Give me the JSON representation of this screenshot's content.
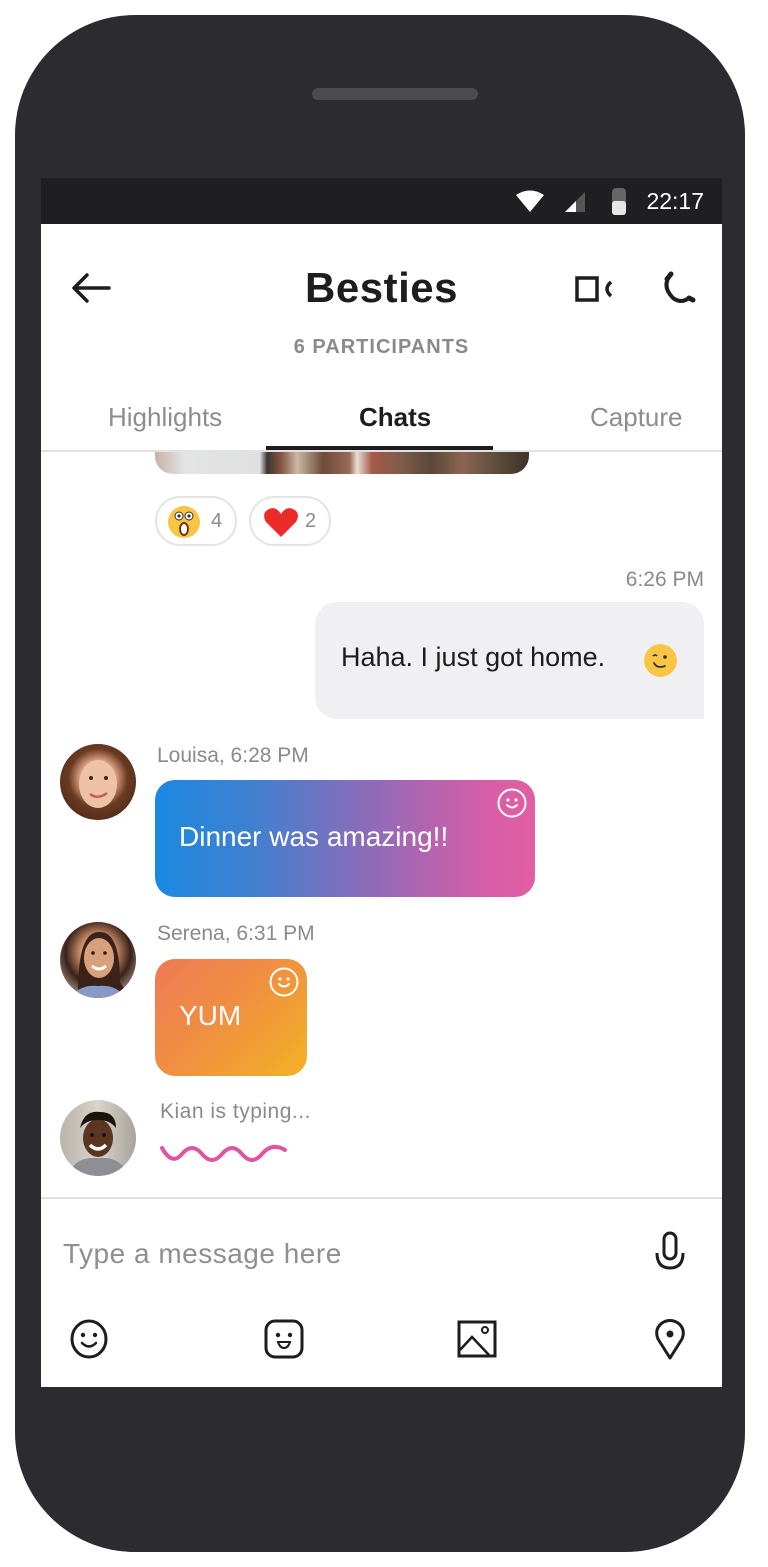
{
  "status_bar": {
    "time": "22:17",
    "icons": [
      "wifi-icon",
      "cell-signal-icon",
      "battery-icon"
    ]
  },
  "header": {
    "title": "Besties",
    "subtitle": "6 PARTICIPANTS",
    "back_icon": "arrow-left-icon",
    "video_call_icon": "video-camera-icon",
    "voice_call_icon": "phone-icon"
  },
  "tabs": [
    {
      "label": "Highlights",
      "active": false
    },
    {
      "label": "Chats",
      "active": true
    },
    {
      "label": "Capture",
      "active": false
    }
  ],
  "reactions": [
    {
      "emoji": "surprised-face",
      "count": "4"
    },
    {
      "emoji": "red-heart",
      "count": "2"
    }
  ],
  "messages": [
    {
      "direction": "outgoing",
      "timestamp": "6:26 PM",
      "text": "Haha. I just got home.",
      "emoji": "winking-face"
    },
    {
      "direction": "incoming",
      "sender_line": "Louisa, 6:28 PM",
      "text": "Dinner was amazing!!",
      "gradient": [
        "#1a89e0",
        "#e25ea3"
      ]
    },
    {
      "direction": "incoming",
      "sender_line": "Serena, 6:31 PM",
      "text": "YUM",
      "gradient": [
        "#ee7b55",
        "#f2b225"
      ]
    }
  ],
  "typing": {
    "text": "Kian is typing...",
    "indicator_color": "#e0559f"
  },
  "composer": {
    "placeholder": "Type a message here",
    "value": "",
    "toolbar": [
      "emoji-icon",
      "sticker-icon",
      "image-icon",
      "location-pin-icon"
    ]
  },
  "colors": {
    "phone_frame": "#2c2b30",
    "status_bar": "#1f1f21",
    "outgoing_bubble": "#f0f0f3",
    "muted_text": "#8a8a8e",
    "primary_text": "#1d1d1f"
  }
}
